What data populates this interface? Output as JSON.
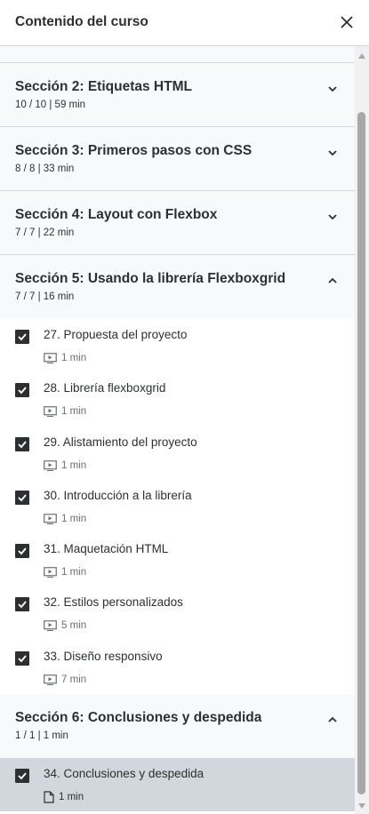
{
  "header": {
    "title": "Contenido del curso"
  },
  "sections": [
    {
      "title": "Sección 2: Etiquetas HTML",
      "meta": "10 / 10 | 59 min",
      "expanded": false
    },
    {
      "title": "Sección 3: Primeros pasos con CSS",
      "meta": "8 / 8 | 33 min",
      "expanded": false
    },
    {
      "title": "Sección 4: Layout con Flexbox",
      "meta": "7 / 7 | 22 min",
      "expanded": false
    },
    {
      "title": "Sección 5: Usando la librería Flexboxgrid",
      "meta": "7 / 7 | 16 min",
      "expanded": true,
      "items": [
        {
          "title": "27. Propuesta del proyecto",
          "duration": "1 min",
          "icon": "video-icon",
          "checked": true
        },
        {
          "title": "28. Librería flexboxgrid",
          "duration": "1 min",
          "icon": "video-icon",
          "checked": true
        },
        {
          "title": "29. Alistamiento del proyecto",
          "duration": "1 min",
          "icon": "video-icon",
          "checked": true
        },
        {
          "title": "30. Introducción a la librería",
          "duration": "1 min",
          "icon": "video-icon",
          "checked": true
        },
        {
          "title": "31. Maquetación HTML",
          "duration": "1 min",
          "icon": "video-icon",
          "checked": true
        },
        {
          "title": "32. Estilos personalizados",
          "duration": "5 min",
          "icon": "video-icon",
          "checked": true
        },
        {
          "title": "33. Diseño responsivo",
          "duration": "7 min",
          "icon": "video-icon",
          "checked": true
        }
      ]
    },
    {
      "title": "Sección 6: Conclusiones y despedida",
      "meta": "1 / 1 | 1 min",
      "expanded": true,
      "items": [
        {
          "title": "34. Conclusiones y despedida",
          "duration": "1 min",
          "icon": "article-icon",
          "checked": true,
          "active": true
        }
      ]
    }
  ],
  "colors": {
    "text": "#2d2f31",
    "section_bg": "#f7f9fa",
    "active_bg": "#d1d7dc",
    "border": "#d1d7dc"
  }
}
